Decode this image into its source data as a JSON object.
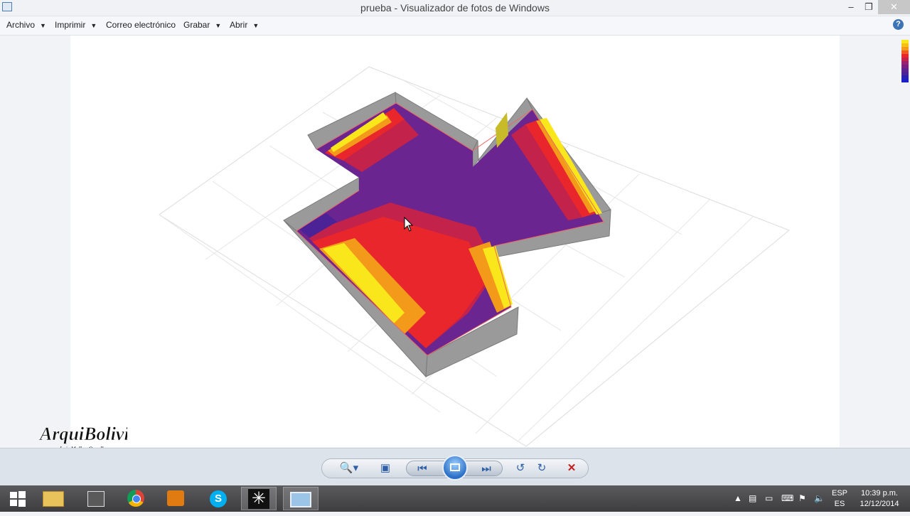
{
  "window": {
    "title": "prueba - Visualizador de fotos de Windows",
    "minimize": "–",
    "maximize": "❐",
    "close": "✕"
  },
  "menu": {
    "archivo": "Archivo",
    "imprimir": "Imprimir",
    "correo": "Correo electrónico",
    "grabar": "Grabar",
    "abrir": "Abrir",
    "help": "?"
  },
  "colors": {
    "yellow": "#f9e61b",
    "orange": "#f39a1a",
    "red": "#e8262b",
    "crimson": "#c3224b",
    "purple": "#7a1f7e",
    "indigo": "#4b2396",
    "wall": "#8f8f8f"
  },
  "logo": {
    "text": "ArquiBolivia",
    "subtitle": "Luis Mallea Orgolla"
  },
  "toolbar": {
    "zoom_icon": "magnifier-icon",
    "fit_icon": "fit-window-icon",
    "prev_icon": "previous-icon",
    "slideshow_icon": "slideshow-icon",
    "next_icon": "next-icon",
    "rotate_left_icon": "rotate-left-icon",
    "rotate_right_icon": "rotate-right-icon",
    "delete_icon": "delete-icon"
  },
  "taskbar": {
    "start_icon": "windows-start-icon",
    "apps": [
      "file-explorer-icon",
      "printer-app-icon",
      "chrome-icon",
      "media-app-icon",
      "skype-icon",
      "star-app-icon",
      "photo-viewer-icon"
    ],
    "lang_top": "ESP",
    "lang_bottom": "ES",
    "time": "10:39 p.m.",
    "date": "12/12/2014"
  }
}
